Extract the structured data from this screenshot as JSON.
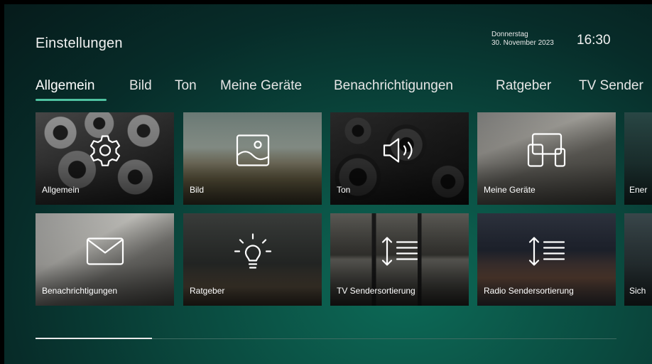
{
  "header": {
    "title": "Einstellungen",
    "weekday": "Donnerstag",
    "date": "30. November 2023",
    "time": "16:30"
  },
  "tabs": [
    {
      "label": "Allgemein",
      "active": true
    },
    {
      "label": "Bild"
    },
    {
      "label": "Ton"
    },
    {
      "label": "Meine Geräte"
    },
    {
      "label": "Benachrichtigungen"
    },
    {
      "label": "Ratgeber"
    },
    {
      "label": "TV Sender"
    }
  ],
  "tiles": [
    {
      "label": "Allgemein",
      "icon": "gear-icon"
    },
    {
      "label": "Bild",
      "icon": "picture-icon"
    },
    {
      "label": "Ton",
      "icon": "speaker-icon"
    },
    {
      "label": "Meine Geräte",
      "icon": "devices-icon"
    },
    {
      "label": "Ener",
      "icon": ""
    },
    {
      "label": "Benachrichtigungen",
      "icon": "envelope-icon"
    },
    {
      "label": "Ratgeber",
      "icon": "lightbulb-icon"
    },
    {
      "label": "TV Sendersortierung",
      "icon": "sort-list-icon"
    },
    {
      "label": "Radio Sendersortierung",
      "icon": "sort-list-icon"
    },
    {
      "label": "Sich",
      "icon": ""
    }
  ],
  "scroll": {
    "position_fraction": 0.2
  },
  "colors": {
    "accent": "#4fc3a1",
    "background": "#0a4a3f"
  }
}
